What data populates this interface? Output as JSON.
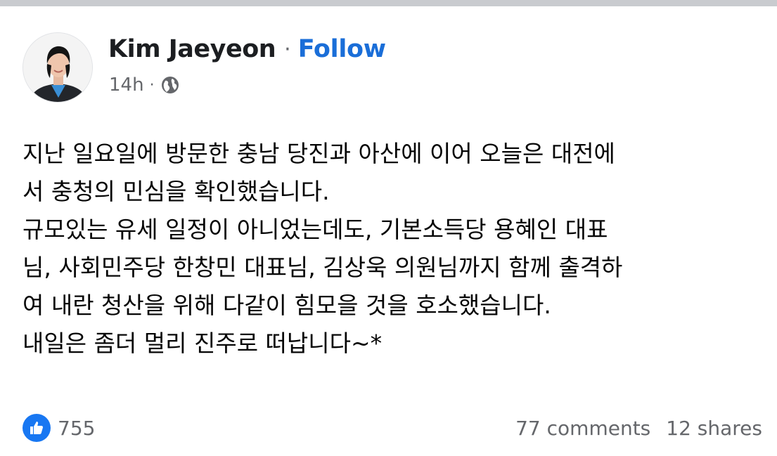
{
  "post": {
    "author": "Kim Jaeyeon",
    "separator": "·",
    "follow_label": "Follow",
    "time": "14h",
    "time_separator": "·",
    "audience_icon": "globe-icon",
    "body_lines": [
      "지난 일요일에 방문한 충남 당진과 아산에 이어 오늘은 대전에",
      "서 충청의 민심을 확인했습니다.",
      "규모있는 유세 일정이 아니었는데도, 기본소득당 용혜인 대표",
      "님, 사회민주당 한창민 대표님, 김상욱 의원님까지 함께 출격하",
      "여 내란 청산을 위해 다같이 힘모을 것을 호소했습니다.",
      "내일은 좀더 멀리 진주로 떠납니다~*"
    ],
    "reactions": {
      "icon": "like-icon",
      "count": "755"
    },
    "comments": "77 comments",
    "shares": "12 shares"
  },
  "colors": {
    "follow": "#1a6ed8",
    "like_badge": "#1877f2",
    "meta_text": "#65676b",
    "body_text": "#050505",
    "top_rule": "#c9cbcf"
  }
}
